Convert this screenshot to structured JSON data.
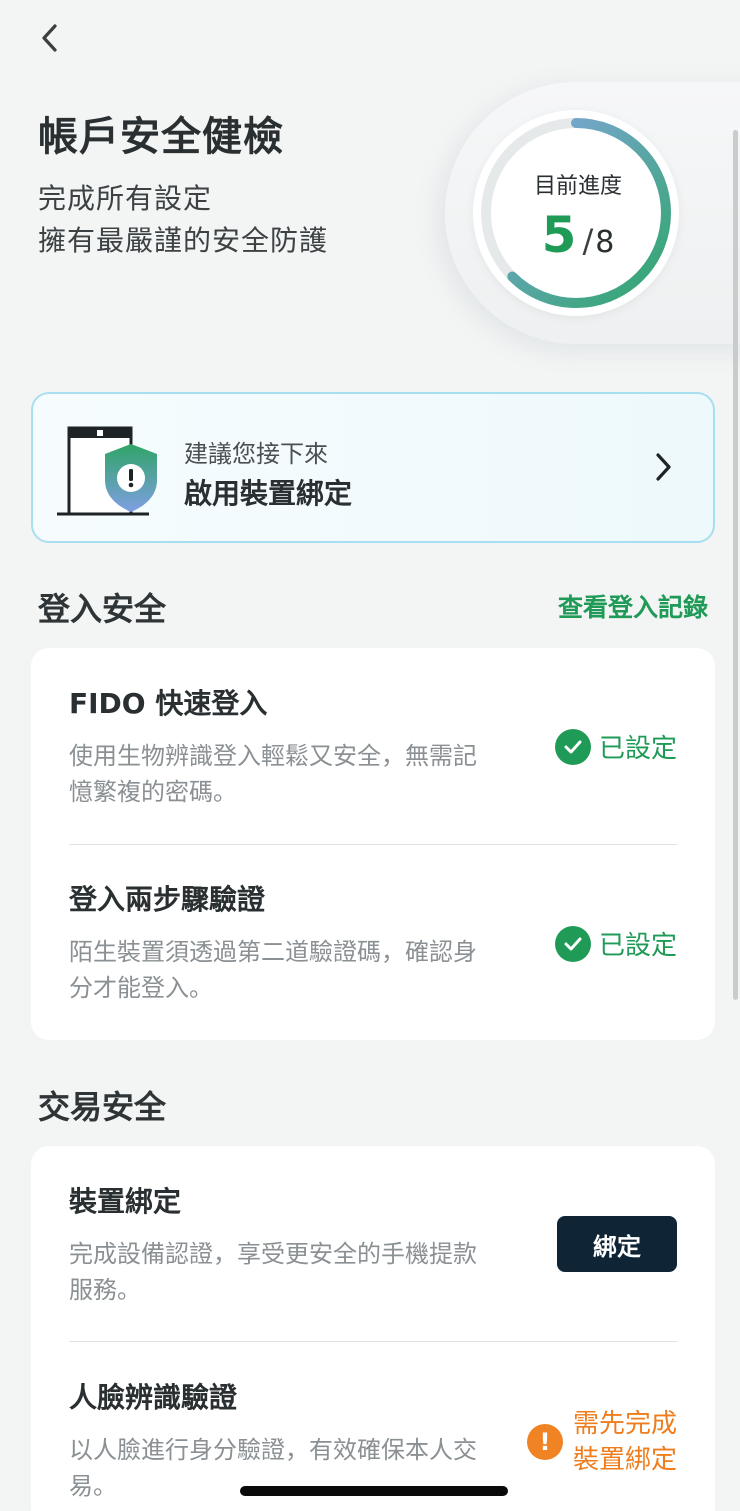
{
  "header": {
    "title": "帳戶安全健檢",
    "subtitle_line1": "完成所有設定",
    "subtitle_line2": "擁有最嚴謹的安全防護"
  },
  "progress": {
    "label": "目前進度",
    "current": "5",
    "separator": "/",
    "total": "8",
    "fraction": 0.625,
    "colors": {
      "start": "#2ea66a",
      "end": "#8aa6e8",
      "track": "#e6e9ea"
    }
  },
  "suggestion": {
    "hint": "建議您接下來",
    "action": "啟用裝置綁定"
  },
  "login_security": {
    "title": "登入安全",
    "link": "查看登入記錄",
    "items": [
      {
        "title": "FIDO 快速登入",
        "desc": "使用生物辨識登入輕鬆又安全，無需記憶繁複的密碼。",
        "status": "已設定"
      },
      {
        "title": "登入兩步驟驗證",
        "desc": "陌生裝置須透過第二道驗證碼，確認身分才能登入。",
        "status": "已設定"
      }
    ]
  },
  "transaction_security": {
    "title": "交易安全",
    "items": [
      {
        "title": "裝置綁定",
        "desc": "完成設備認證，享受更安全的手機提款服務。",
        "button": "綁定"
      },
      {
        "title": "人臉辨識驗證",
        "desc": "以人臉進行身分驗證，有效確保本人交易。",
        "warning_line1": "需先完成",
        "warning_line2": "裝置綁定"
      }
    ]
  },
  "colors": {
    "accent_green": "#1f9a57",
    "warning_orange": "#ef7d1e",
    "button_dark": "#0f2536",
    "card_border": "#a8dff0"
  }
}
